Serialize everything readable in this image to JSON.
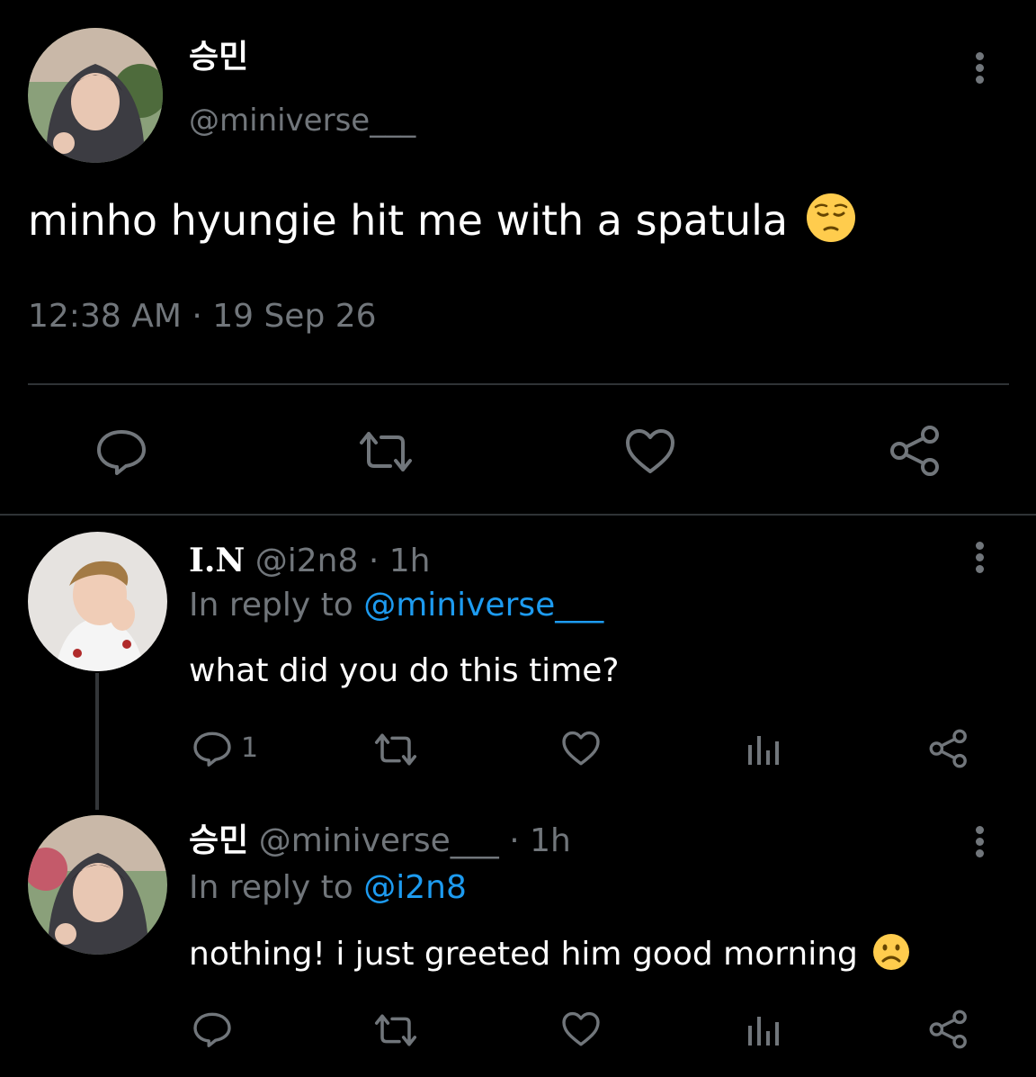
{
  "main_tweet": {
    "display_name": "승민",
    "handle": "@miniverse___",
    "text": "minho hyungie hit me with a spatula",
    "emoji": "😔",
    "timestamp": "12:38 AM · 19 Sep 26",
    "avatar_icon": "user-photo"
  },
  "replies": [
    {
      "display_name": "I.N",
      "handle": "@i2n8",
      "time": "· 1h",
      "reply_prefix": "In reply to ",
      "reply_to": "@miniverse___",
      "text": "what did you do this time?",
      "reply_count": "1"
    },
    {
      "display_name": "승민",
      "handle": "@miniverse___",
      "time": "· 1h",
      "reply_prefix": "In reply to ",
      "reply_to": "@i2n8",
      "text": "nothing! i just greeted him good morning",
      "emoji": "☹️"
    }
  ],
  "colors": {
    "background": "#000000",
    "muted": "#71767b",
    "link": "#1d9bf0",
    "divider": "#2f3336"
  }
}
